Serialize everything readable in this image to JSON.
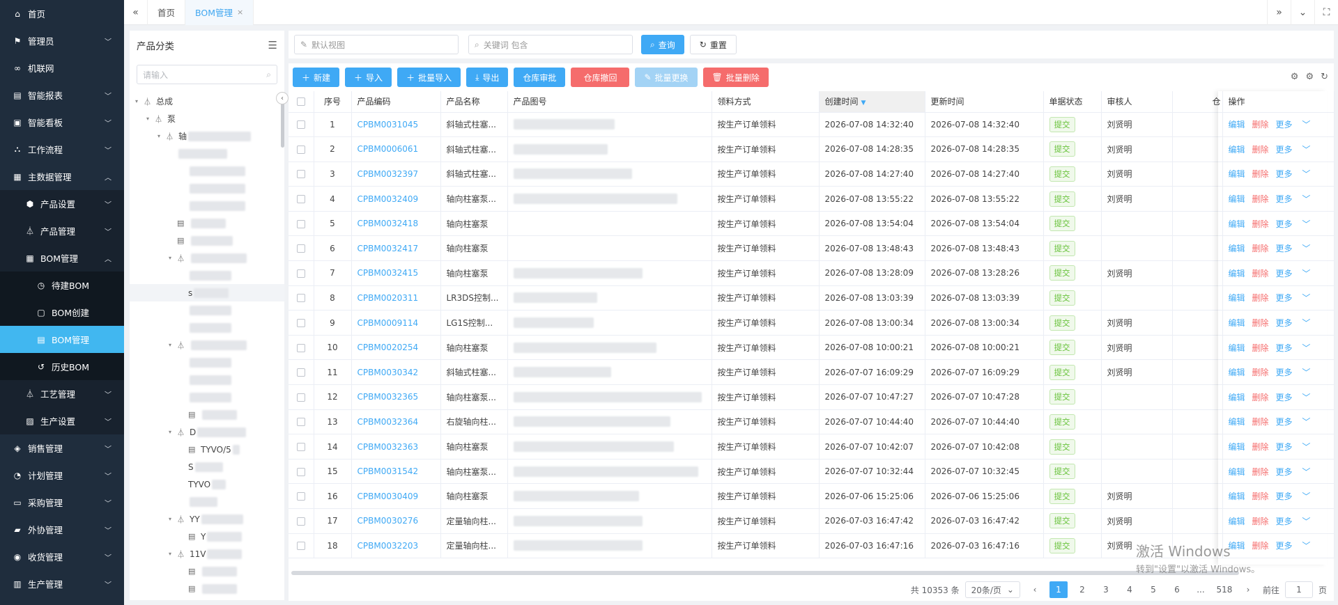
{
  "sidebar": {
    "items": [
      {
        "label": "首页",
        "icon": "home-icon",
        "level": 0,
        "chev": ""
      },
      {
        "label": "管理员",
        "icon": "user-icon",
        "level": 0,
        "chev": "down"
      },
      {
        "label": "机联网",
        "icon": "link-icon",
        "level": 0,
        "chev": ""
      },
      {
        "label": "智能报表",
        "icon": "report-icon",
        "level": 0,
        "chev": "down"
      },
      {
        "label": "智能看板",
        "icon": "dashboard-icon",
        "level": 0,
        "chev": "down"
      },
      {
        "label": "工作流程",
        "icon": "workflow-icon",
        "level": 0,
        "chev": "down"
      },
      {
        "label": "主数据管理",
        "icon": "master-data-icon",
        "level": 0,
        "chev": "up"
      },
      {
        "label": "产品设置",
        "icon": "cube-icon",
        "level": 1,
        "chev": "down"
      },
      {
        "label": "产品管理",
        "icon": "tree-icon",
        "level": 1,
        "chev": "down"
      },
      {
        "label": "BOM管理",
        "icon": "grid-icon",
        "level": 1,
        "chev": "up"
      },
      {
        "label": "待建BOM",
        "icon": "clock-icon",
        "level": 2,
        "chev": ""
      },
      {
        "label": "BOM创建",
        "icon": "doc-add-icon",
        "level": 2,
        "chev": ""
      },
      {
        "label": "BOM管理",
        "icon": "doc-edit-icon",
        "level": 2,
        "chev": "",
        "active": true
      },
      {
        "label": "历史BOM",
        "icon": "history-icon",
        "level": 2,
        "chev": ""
      },
      {
        "label": "工艺管理",
        "icon": "tree-icon",
        "level": 1,
        "chev": "down"
      },
      {
        "label": "生产设置",
        "icon": "image-icon",
        "level": 1,
        "chev": "down"
      },
      {
        "label": "销售管理",
        "icon": "sales-icon",
        "level": 0,
        "chev": "down"
      },
      {
        "label": "计划管理",
        "icon": "plan-icon",
        "level": 0,
        "chev": "down"
      },
      {
        "label": "采购管理",
        "icon": "purchase-icon",
        "level": 0,
        "chev": "down"
      },
      {
        "label": "外协管理",
        "icon": "outsource-icon",
        "level": 0,
        "chev": "down"
      },
      {
        "label": "收货管理",
        "icon": "receive-icon",
        "level": 0,
        "chev": "down"
      },
      {
        "label": "生产管理",
        "icon": "production-icon",
        "level": 0,
        "chev": "down"
      }
    ]
  },
  "tabs": {
    "home": "首页",
    "bom": "BOM管理",
    "close": "×"
  },
  "tree": {
    "title": "产品分类",
    "search_placeholder": "请输入",
    "nodes": [
      {
        "label": "总成",
        "indent": 0,
        "caret": "▾",
        "icon": "⏃"
      },
      {
        "label": "泵",
        "indent": 1,
        "caret": "▾",
        "icon": "⏃"
      },
      {
        "label": "轴",
        "indent": 2,
        "caret": "▾",
        "icon": "⏃",
        "blur": 90
      },
      {
        "label": "",
        "indent": 3,
        "caret": "",
        "icon": "",
        "blur": 70
      },
      {
        "label": "",
        "indent": 4,
        "caret": "",
        "icon": "",
        "blur": 80
      },
      {
        "label": "",
        "indent": 4,
        "caret": "",
        "icon": "",
        "blur": 80
      },
      {
        "label": "",
        "indent": 4,
        "caret": "",
        "icon": "",
        "blur": 80
      },
      {
        "label": "",
        "indent": 3,
        "caret": "",
        "icon": "▤",
        "blur": 50
      },
      {
        "label": "",
        "indent": 3,
        "caret": "",
        "icon": "▤",
        "blur": 60
      },
      {
        "label": "",
        "indent": 3,
        "caret": "▾",
        "icon": "⏃",
        "blur": 80
      },
      {
        "label": "",
        "indent": 4,
        "caret": "",
        "icon": "",
        "blur": 60
      },
      {
        "label": "s",
        "indent": 4,
        "caret": "",
        "icon": "",
        "blur": 50
      },
      {
        "label": "",
        "indent": 4,
        "caret": "",
        "icon": "",
        "blur": 60
      },
      {
        "label": "",
        "indent": 4,
        "caret": "",
        "icon": "",
        "blur": 60
      },
      {
        "label": "",
        "indent": 3,
        "caret": "▾",
        "icon": "⏃",
        "blur": 80
      },
      {
        "label": "",
        "indent": 4,
        "caret": "",
        "icon": "",
        "blur": 60
      },
      {
        "label": "",
        "indent": 4,
        "caret": "",
        "icon": "",
        "blur": 60
      },
      {
        "label": "",
        "indent": 4,
        "caret": "",
        "icon": "",
        "blur": 60
      },
      {
        "label": "",
        "indent": 4,
        "caret": "",
        "icon": "▤",
        "blur": 50
      },
      {
        "label": "D",
        "indent": 3,
        "caret": "▾",
        "icon": "⏃",
        "blur": 70
      },
      {
        "label": "TYVO/5",
        "indent": 4,
        "caret": "",
        "icon": "▤",
        "blur": 10
      },
      {
        "label": "S",
        "indent": 4,
        "caret": "",
        "icon": "",
        "blur": 40
      },
      {
        "label": "TYVO",
        "indent": 4,
        "caret": "",
        "icon": "",
        "blur": 20
      },
      {
        "label": "",
        "indent": 4,
        "caret": "",
        "icon": "",
        "blur": 40
      },
      {
        "label": "YY",
        "indent": 3,
        "caret": "▾",
        "icon": "⏃",
        "blur": 60
      },
      {
        "label": "Y",
        "indent": 4,
        "caret": "",
        "icon": "▤",
        "blur": 50
      },
      {
        "label": "11V",
        "indent": 3,
        "caret": "▾",
        "icon": "⏃",
        "blur": 50
      },
      {
        "label": "",
        "indent": 4,
        "caret": "",
        "icon": "▤",
        "blur": 50
      },
      {
        "label": "",
        "indent": 4,
        "caret": "",
        "icon": "▤",
        "blur": 50
      }
    ]
  },
  "filter": {
    "view_placeholder": "默认视图",
    "keyword_placeholder": "关键词 包含",
    "query_label": "查询",
    "reset_label": "重置"
  },
  "toolbar": {
    "new_label": "新建",
    "import_label": "导入",
    "batch_import_label": "批量导入",
    "export_label": "导出",
    "warehouse_approve_label": "仓库审批",
    "warehouse_revoke_label": "仓库撤回",
    "batch_replace_label": "批量更换",
    "batch_delete_label": "批量删除"
  },
  "table": {
    "headers": {
      "index": "序号",
      "code": "产品编码",
      "name": "产品名称",
      "drawing": "产品图号",
      "method": "领料方式",
      "created": "创建时间",
      "updated": "更新时间",
      "status": "单据状态",
      "reviewer": "审核人",
      "extra": "仓",
      "ops": "操作"
    },
    "op_labels": {
      "edit": "编辑",
      "del": "删除",
      "more": "更多"
    },
    "rows": [
      {
        "idx": "1",
        "code": "CPBM0031045",
        "name": "斜轴式柱塞...",
        "drawing_blur": 145,
        "method": "按生产订单领料",
        "created": "2026-07-08 14:32:40",
        "updated": "2026-07-08 14:32:40",
        "status": "提交",
        "reviewer": "刘贤明"
      },
      {
        "idx": "2",
        "code": "CPBM0006061",
        "name": "斜轴式柱塞...",
        "drawing_blur": 135,
        "method": "按生产订单领料",
        "created": "2026-07-08 14:28:35",
        "updated": "2026-07-08 14:28:35",
        "status": "提交",
        "reviewer": "刘贤明"
      },
      {
        "idx": "3",
        "code": "CPBM0032397",
        "name": "斜轴式柱塞...",
        "drawing_blur": 170,
        "method": "按生产订单领料",
        "created": "2026-07-08 14:27:40",
        "updated": "2026-07-08 14:27:40",
        "status": "提交",
        "reviewer": "刘贤明"
      },
      {
        "idx": "4",
        "code": "CPBM0032409",
        "name": "轴向柱塞泵...",
        "drawing_blur": 235,
        "method": "按生产订单领料",
        "created": "2026-07-08 13:55:22",
        "updated": "2026-07-08 13:55:22",
        "status": "提交",
        "reviewer": "刘贤明"
      },
      {
        "idx": "5",
        "code": "CPBM0032418",
        "name": "轴向柱塞泵",
        "drawing_blur": 0,
        "method": "按生产订单领料",
        "created": "2026-07-08 13:54:04",
        "updated": "2026-07-08 13:54:04",
        "status": "提交",
        "reviewer": ""
      },
      {
        "idx": "6",
        "code": "CPBM0032417",
        "name": "轴向柱塞泵",
        "drawing_blur": 0,
        "method": "按生产订单领料",
        "created": "2026-07-08 13:48:43",
        "updated": "2026-07-08 13:48:43",
        "status": "提交",
        "reviewer": ""
      },
      {
        "idx": "7",
        "code": "CPBM0032415",
        "name": "轴向柱塞泵",
        "drawing_blur": 185,
        "method": "按生产订单领料",
        "created": "2026-07-08 13:28:09",
        "updated": "2026-07-08 13:28:26",
        "status": "提交",
        "reviewer": "刘贤明"
      },
      {
        "idx": "8",
        "code": "CPBM0020311",
        "name": "LR3DS控制...",
        "drawing_blur": 120,
        "method": "按生产订单领料",
        "created": "2026-07-08 13:03:39",
        "updated": "2026-07-08 13:03:39",
        "status": "提交",
        "reviewer": ""
      },
      {
        "idx": "9",
        "code": "CPBM0009114",
        "name": "LG1S控制...",
        "drawing_blur": 115,
        "method": "按生产订单领料",
        "created": "2026-07-08 13:00:34",
        "updated": "2026-07-08 13:00:34",
        "status": "提交",
        "reviewer": "刘贤明"
      },
      {
        "idx": "10",
        "code": "CPBM0020254",
        "name": "轴向柱塞泵",
        "drawing_blur": 205,
        "method": "按生产订单领料",
        "created": "2026-07-08 10:00:21",
        "updated": "2026-07-08 10:00:21",
        "status": "提交",
        "reviewer": "刘贤明"
      },
      {
        "idx": "11",
        "code": "CPBM0030342",
        "name": "斜轴式柱塞...",
        "drawing_blur": 140,
        "method": "按生产订单领料",
        "created": "2026-07-07 16:09:29",
        "updated": "2026-07-07 16:09:29",
        "status": "提交",
        "reviewer": "刘贤明"
      },
      {
        "idx": "12",
        "code": "CPBM0032365",
        "name": "轴向柱塞泵...",
        "drawing_blur": 270,
        "method": "按生产订单领料",
        "created": "2026-07-07 10:47:27",
        "updated": "2026-07-07 10:47:28",
        "status": "提交",
        "reviewer": ""
      },
      {
        "idx": "13",
        "code": "CPBM0032364",
        "name": "右旋轴向柱...",
        "drawing_blur": 225,
        "method": "按生产订单领料",
        "created": "2026-07-07 10:44:40",
        "updated": "2026-07-07 10:44:40",
        "status": "提交",
        "reviewer": ""
      },
      {
        "idx": "14",
        "code": "CPBM0032363",
        "name": "轴向柱塞泵",
        "drawing_blur": 230,
        "method": "按生产订单领料",
        "created": "2026-07-07 10:42:07",
        "updated": "2026-07-07 10:42:08",
        "status": "提交",
        "reviewer": ""
      },
      {
        "idx": "15",
        "code": "CPBM0031542",
        "name": "轴向柱塞泵...",
        "drawing_blur": 265,
        "method": "按生产订单领料",
        "created": "2026-07-07 10:32:44",
        "updated": "2026-07-07 10:32:45",
        "status": "提交",
        "reviewer": ""
      },
      {
        "idx": "16",
        "code": "CPBM0030409",
        "name": "轴向柱塞泵",
        "drawing_blur": 180,
        "method": "按生产订单领料",
        "created": "2026-07-06 15:25:06",
        "updated": "2026-07-06 15:25:06",
        "status": "提交",
        "reviewer": "刘贤明"
      },
      {
        "idx": "17",
        "code": "CPBM0030276",
        "name": "定量轴向柱...",
        "drawing_blur": 185,
        "method": "按生产订单领料",
        "created": "2026-07-03 16:47:42",
        "updated": "2026-07-03 16:47:42",
        "status": "提交",
        "reviewer": "刘贤明"
      },
      {
        "idx": "18",
        "code": "CPBM0032203",
        "name": "定量轴向柱...",
        "drawing_blur": 185,
        "method": "按生产订单领料",
        "created": "2026-07-03 16:47:16",
        "updated": "2026-07-03 16:47:16",
        "status": "提交",
        "reviewer": "刘贤明"
      }
    ]
  },
  "pager": {
    "total": "共 10353 条",
    "page_size": "20条/页",
    "pages": [
      "1",
      "2",
      "3",
      "4",
      "5",
      "6",
      "...",
      "518"
    ],
    "current": "1",
    "goto_label": "前往",
    "goto_value": "1",
    "page_unit": "页"
  },
  "watermark": {
    "line1": "激活 Windows",
    "line2": "转到\"设置\"以激活 Windows。"
  }
}
